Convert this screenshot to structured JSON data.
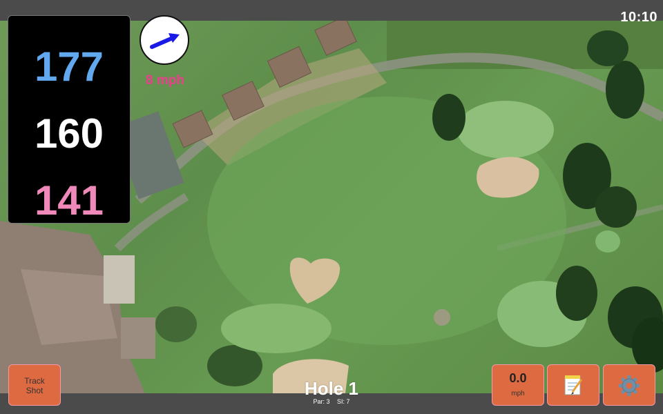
{
  "status_bar": {
    "time": "10:10"
  },
  "distances": {
    "back": "177",
    "middle": "160",
    "front": "141"
  },
  "wind": {
    "speed": "8 mph",
    "icon": "wind-arrow-icon",
    "arrow_color": "#1a1ae6"
  },
  "buttons": {
    "track_shot_line1": "Track",
    "track_shot_line2": "Shot",
    "speed_value": "0.0",
    "speed_unit": "mph",
    "notes_icon": "notepad-icon",
    "settings_icon": "gear-icon"
  },
  "hole": {
    "title": "Hole 1",
    "par": "Par: 3",
    "stroke_index": "SI: 7"
  },
  "colors": {
    "button_bg": "#dd6a40",
    "back_distance": "#62a8ee",
    "middle_distance": "#ffffff",
    "front_distance": "#ef89b9",
    "wind_text": "#ec3e8c"
  }
}
